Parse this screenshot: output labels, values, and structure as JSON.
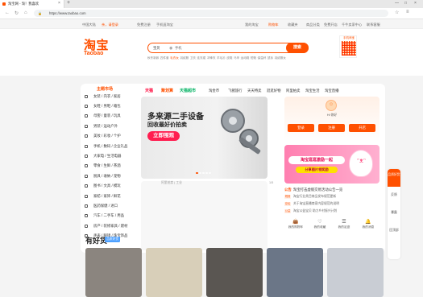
{
  "browser": {
    "tab_title": "淘宝网 - 淘！我喜欢",
    "tab_close": "×",
    "new_tab": "+",
    "url": "https://www.taobao.com",
    "window_controls": [
      "—",
      "□",
      "×"
    ]
  },
  "site_nav": {
    "left": [
      "中国大陆",
      "亲，请登录",
      "免费注册",
      "手机逛淘宝"
    ],
    "right": [
      "我的淘宝",
      "购物车",
      "收藏夹",
      "商品分类",
      "免费开店",
      "千牛卖家中心",
      "联系客服"
    ]
  },
  "header": {
    "logo_cn": "淘宝",
    "logo_en": "Taobao",
    "search_category": "宝贝",
    "search_placeholder": "手机",
    "search_button": "搜索",
    "qr_label": "手机淘宝",
    "hotwords": [
      "秋冬新款",
      "四件套",
      "毛衣女",
      "羽绒服",
      "卫衣",
      "连衣裙",
      "冲锋衣",
      "羊毛衫",
      "皮鞋",
      "马甲",
      "运动鞋",
      "短靴",
      "保温杯",
      "鼠标",
      "羽绒服女"
    ],
    "hot_highlight": "毛衣女"
  },
  "channels": {
    "primary": [
      {
        "label": "天猫",
        "color": "#ff0036"
      },
      {
        "label": "聚划算",
        "color": "#ff5000"
      },
      {
        "label": "天猫超市",
        "color": "#00b262"
      }
    ],
    "secondary": [
      "淘金币",
      "飞猪旅行",
      "天天特卖",
      "逛逛好物",
      "阿里拍卖",
      "淘宝生活",
      "淘宝直播"
    ]
  },
  "categories": {
    "title": "主题市场",
    "items": [
      "女装 / 内衣 / 家居",
      "女鞋 / 男鞋 / 箱包",
      "母婴 / 童装 / 玩具",
      "男装 / 运动户外",
      "美妆 / 彩妆 / 个护",
      "手机 / 数码 / 企业礼品",
      "大家电 / 生活电器",
      "零食 / 生鲜 / 茶酒",
      "厨具 / 收纳 / 宠物",
      "图书 / 文具 / 模玩",
      "家纺 / 家饰 / 鲜花",
      "医药保健 / 进口",
      "汽车 / 二手车 / 用品",
      "房产 / 装修家具 / 建材",
      "手表 / 眼镜 / 珠宝饰品"
    ]
  },
  "banner": {
    "title": "多来源二手设备",
    "subtitle": "回收最好价拍卖",
    "button": "立即围观",
    "caption": "阿里拍卖 | 工业",
    "pager": "1/5",
    "slide_count": 5,
    "active_slide": 1
  },
  "user": {
    "greeting": "Hi 你好",
    "buttons": [
      "登录",
      "注册",
      "开店"
    ]
  },
  "promo": {
    "line1": "淘宝逛逛激励一起",
    "line2": "分享图片领奖励"
  },
  "news": {
    "tag": "公告",
    "headline": "淘宝打击虚假交易活动公告一览",
    "items": [
      {
        "tag": "规则",
        "text": "淘宝行业类目商品发布规范更新"
      },
      {
        "tag": "论坛",
        "text": "关于淘宝直播商家内容规范的说明"
      },
      {
        "tag": "公益",
        "text": "淘宝公益宝贝 助力乡村振兴计划"
      }
    ]
  },
  "tools": [
    {
      "icon": "bag-icon",
      "label": "我的购物车"
    },
    {
      "icon": "heart-icon",
      "label": "我的收藏"
    },
    {
      "icon": "list-icon",
      "label": "我的足迹"
    },
    {
      "icon": "bell-icon",
      "label": "我的消息"
    }
  ],
  "float_bar": {
    "top": "品质好货",
    "items": [
      "反馈",
      "暴露",
      "回顶部"
    ]
  },
  "goods": {
    "title": "有好货",
    "badge": "品质好货",
    "thumbs": [
      "#8b857f",
      "#d8cfb9",
      "#5a5652",
      "#6b7687",
      "#c9cdd4"
    ]
  },
  "colors": {
    "brand": "#ff5000",
    "pink_promo": "#ff7fb0",
    "banner_button": "#ff1e50"
  }
}
